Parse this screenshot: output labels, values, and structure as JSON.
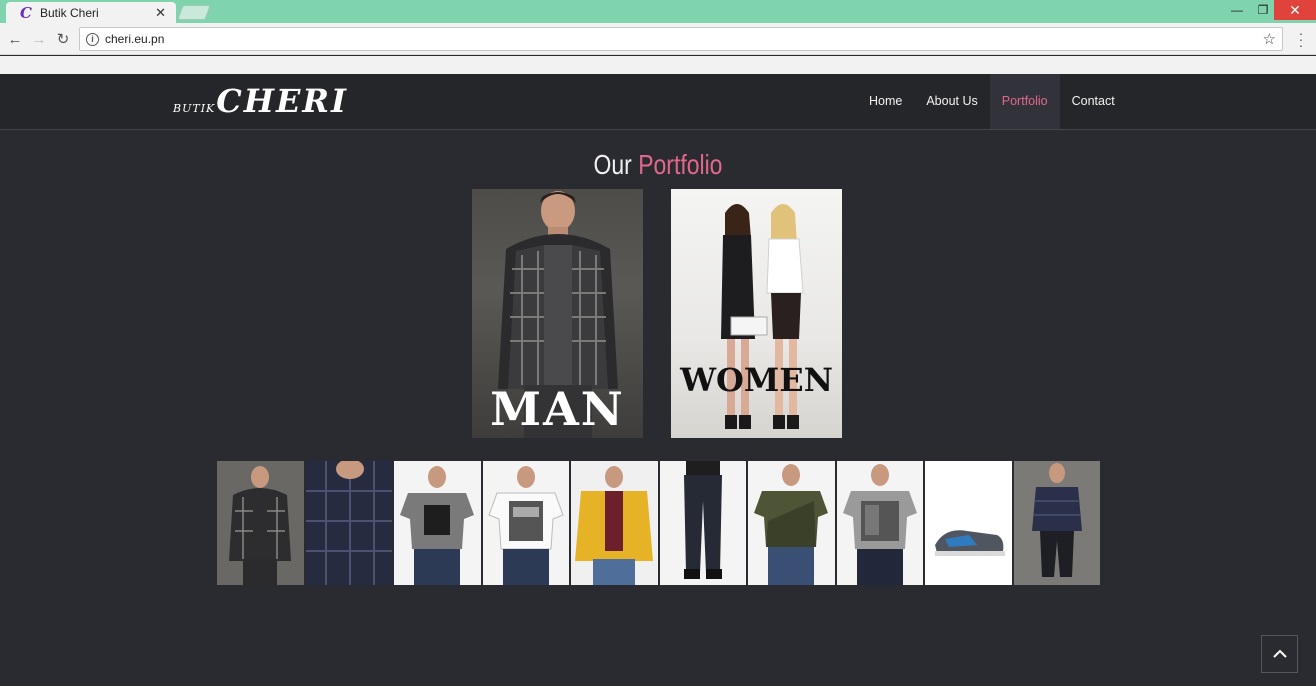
{
  "browser": {
    "tab_title": "Butik Cheri",
    "url": "cheri.eu.pn"
  },
  "site": {
    "logo_small": "BUTIK",
    "logo_big": "CHERI",
    "nav": [
      "Home",
      "About Us",
      "Portfolio",
      "Contact"
    ],
    "active_nav": "Portfolio",
    "accent_color": "#e2678d",
    "background_color": "#2a2b30"
  },
  "portfolio": {
    "title_word1": "Our",
    "title_word2": "Portfolio",
    "features": [
      {
        "label": "MAN"
      },
      {
        "label": "WOMEN"
      }
    ],
    "thumbnails": [
      {
        "item": "plaid jacket"
      },
      {
        "item": "navy puffer jacket"
      },
      {
        "item": "grey graphic tee"
      },
      {
        "item": "white graphic tee"
      },
      {
        "item": "yellow parka"
      },
      {
        "item": "dark jeans"
      },
      {
        "item": "olive v-neck tee"
      },
      {
        "item": "grey print tee"
      },
      {
        "item": "sneaker"
      },
      {
        "item": "navy quilted jacket"
      }
    ]
  }
}
